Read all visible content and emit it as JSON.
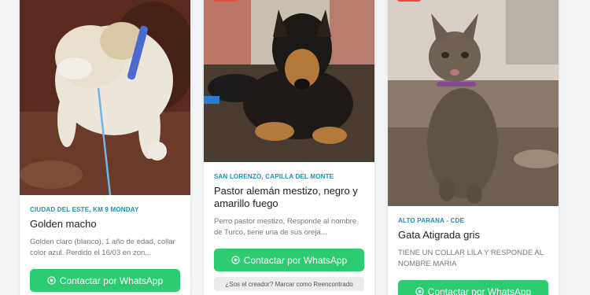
{
  "colors": {
    "accent_location": "#1e8fb0",
    "whatsapp_green": "#2ecc71",
    "badge_red": "#e74c3c"
  },
  "cards": [
    {
      "location": "CIUDAD DEL ESTE, KM 9 MONDAY",
      "title": "Golden macho",
      "description": "Golden claro (blanco), 1 año de edad, collar color azul. Perdido el 16/03 en zon...",
      "whatsapp_label": "Contactar por WhatsApp",
      "photo_icon": "dog-photo"
    },
    {
      "location": "SAN LORENZO, CAPILLA DEL MONTE",
      "title": "Pastor alemán mestizo, negro y amarillo fuego",
      "description": "Perro pastor mestizo, Responde al nombre de Turco, tiene una de sus oreja...",
      "whatsapp_label": "Contactar por WhatsApp",
      "owner_prompt": "¿Sos el creador? Marcar como Reencontrado",
      "photo_icon": "dog-photo"
    },
    {
      "location": "ALTO PARANA - CDE",
      "title": "Gata Atigrada gris",
      "description": "TIENE UN COLLAR LILA Y RESPONDE AL NOMBRE MARIA",
      "whatsapp_label": "Contactar por WhatsApp",
      "photo_icon": "cat-photo"
    }
  ]
}
